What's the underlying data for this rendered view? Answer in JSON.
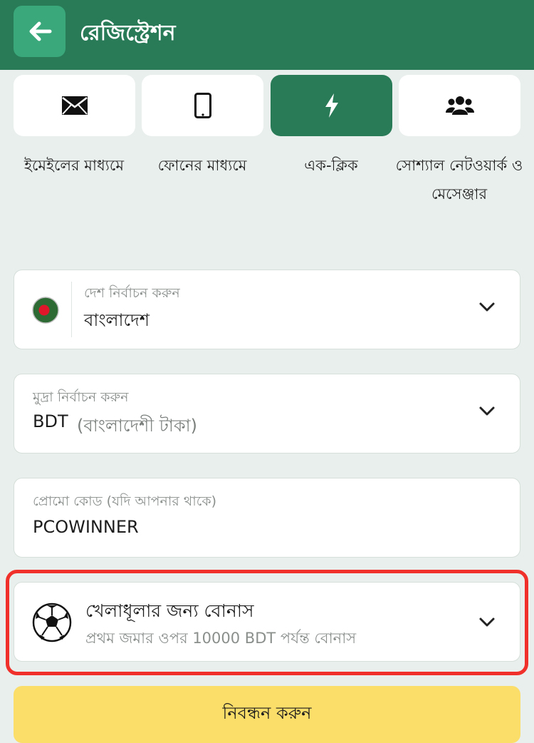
{
  "header": {
    "title": "রেজিস্ট্রেশন"
  },
  "tabs": [
    {
      "label": "ইমেইলের মাধ্যমে",
      "icon": "envelope-icon",
      "active": false
    },
    {
      "label": "ফোনের মাধ্যমে",
      "icon": "phone-icon",
      "active": false
    },
    {
      "label": "এক-ক্লিক",
      "icon": "lightning-icon",
      "active": true
    },
    {
      "label": "সোশ্যাল নেটওয়ার্ক ও মেসেঞ্জার",
      "icon": "users-icon",
      "active": false
    }
  ],
  "country": {
    "label": "দেশ নির্বাচন করুন",
    "value": "বাংলাদেশ"
  },
  "currency": {
    "label": "মুদ্রা নির্বাচন করুন",
    "code": "BDT",
    "name": "(বাংলাদেশী টাকা)"
  },
  "promo": {
    "label": "প্রোমো কোড (যদি আপনার থাকে)",
    "value": "PCOWINNER"
  },
  "bonus": {
    "title": "খেলাধূলার জন্য বোনাস",
    "subtitle": "প্রথম জমার ওপর 10000 BDT পর্যন্ত বোনাস"
  },
  "submit": {
    "label": "নিবন্ধন করুন"
  },
  "colors": {
    "brand": "#297b58",
    "accent": "#fbdd6a",
    "highlight": "#f0302a",
    "background": "#e9efec"
  }
}
